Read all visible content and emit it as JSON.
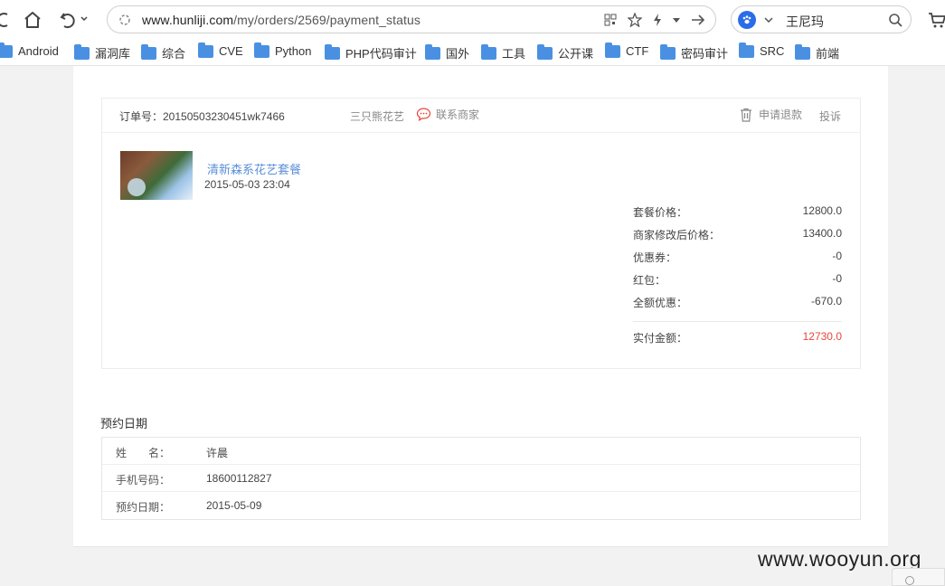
{
  "browser": {
    "url_host": "www.hunliji.com",
    "url_path": "/my/orders/2569/payment_status",
    "search_text": "王尼玛"
  },
  "bookmarks": [
    "Android",
    "漏洞库",
    "综合",
    "CVE",
    "Python",
    "PHP代码审计",
    "国外",
    "工具",
    "公开课",
    "CTF",
    "密码审计",
    "SRC",
    "前端"
  ],
  "order": {
    "number": "订单号：20150503230451wk7466",
    "merchant": "三只熊花艺",
    "contact": "联系商家",
    "refund": "申请退款",
    "complain": "投诉",
    "product_name": "清新森系花艺套餐",
    "product_time": "2015-05-03 23:04",
    "prices": [
      {
        "label": "套餐价格：",
        "value": "12800.0"
      },
      {
        "label": "商家修改后价格：",
        "value": "13400.0"
      },
      {
        "label": "优惠券：",
        "value": "-0"
      },
      {
        "label": "红包：",
        "value": "-0"
      },
      {
        "label": "全额优惠：",
        "value": "-670.0"
      }
    ],
    "total_label": "实付金额：",
    "total_value": "12730.0"
  },
  "appointment": {
    "title": "预约日期",
    "rows": [
      {
        "key": "姓　　名：",
        "value": "许晨"
      },
      {
        "key": "手机号码：",
        "value": "18600112827"
      },
      {
        "key": "预约日期：",
        "value": "2015-05-09"
      }
    ]
  },
  "watermark": "www.wooyun.org",
  "colors": {
    "accent_blue": "#5b8fd8",
    "total_red": "#e9453b",
    "folder_blue": "#4a90e2"
  }
}
